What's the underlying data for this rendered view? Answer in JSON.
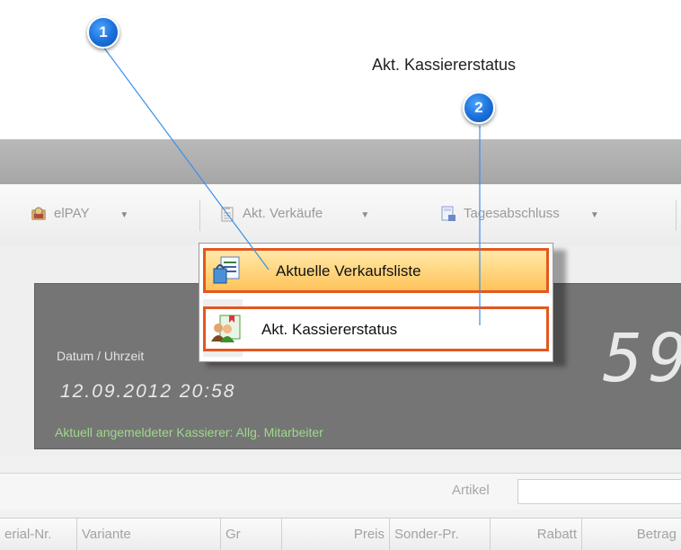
{
  "annotations": {
    "caption": "Akt. Kassiererstatus",
    "callouts": [
      {
        "number": "1"
      },
      {
        "number": "2"
      }
    ]
  },
  "toolbar": {
    "items": [
      {
        "label": "elPAY",
        "icon": "elpay-icon"
      },
      {
        "label": "Akt. Verkäufe",
        "icon": "clipboard-icon"
      },
      {
        "label": "Tagesabschluss",
        "icon": "calculator-icon"
      }
    ]
  },
  "display": {
    "datetime_label": "Datum / Uhrzeit",
    "datetime_value": "12.09.2012 20:58",
    "cashier_status": "Aktuell angemeldeter Kassierer: Allg. Mitarbeiter",
    "big_digits": "59"
  },
  "search": {
    "label": "Artikel",
    "value": ""
  },
  "grid": {
    "columns": [
      "erial-Nr.",
      "Variante",
      "Gr",
      "Preis",
      "Sonder-Pr.",
      "Rabatt",
      "Betrag"
    ]
  },
  "context_menu": {
    "items": [
      {
        "label": "Aktuelle Verkaufsliste",
        "icon": "shopping-bag-list-icon",
        "highlighted": true
      },
      {
        "label": "Akt. Kassiererstatus",
        "icon": "cashier-users-icon",
        "highlighted": false
      }
    ]
  },
  "colors": {
    "highlight_border": "#e4571f",
    "callout_blue": "#1a6fd8",
    "cashier_text": "#9ed98a"
  }
}
